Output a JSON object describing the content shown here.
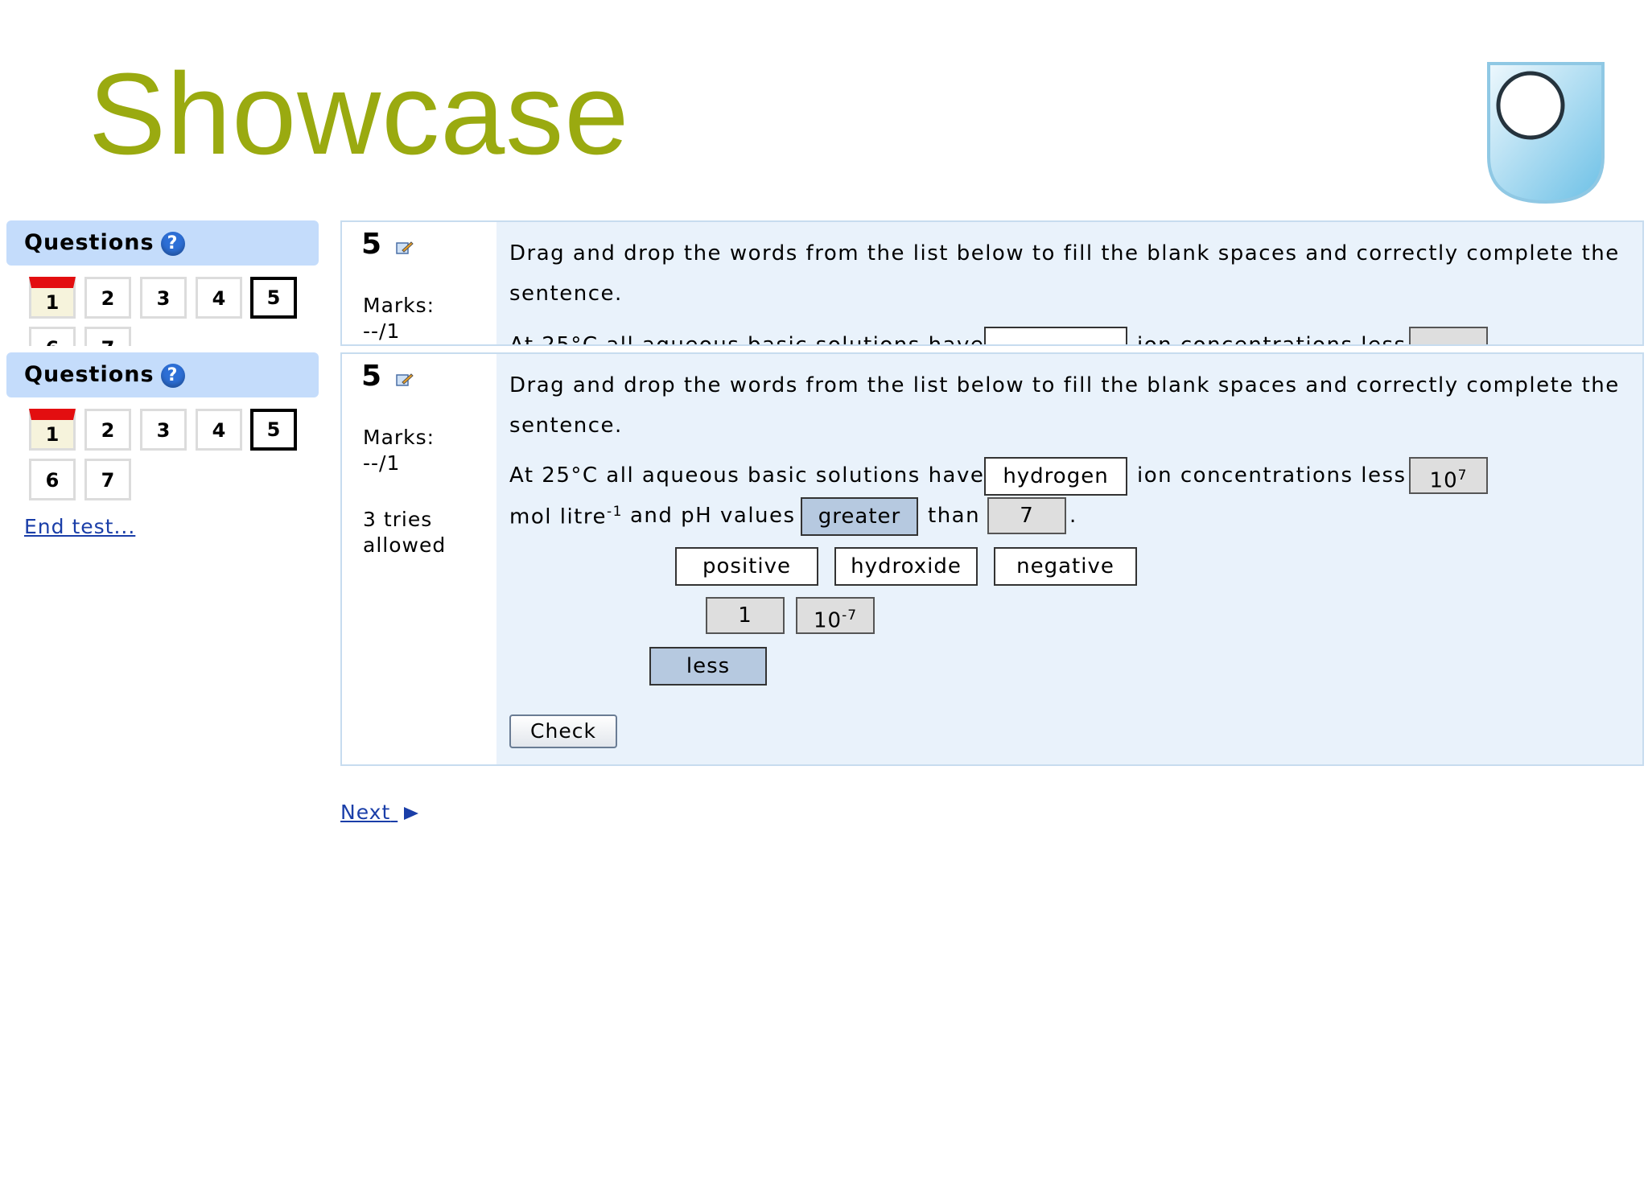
{
  "header": {
    "title": "Showcase"
  },
  "sidebar": {
    "heading": "Questions",
    "help_icon": "?",
    "question_numbers": [
      "1",
      "2",
      "3",
      "4",
      "5",
      "6",
      "7"
    ],
    "current": "5",
    "flagged": "1",
    "end_test": "End test..."
  },
  "question": {
    "number": "5",
    "marks_label": "Marks:",
    "marks_value": "--/1",
    "tries": "3 tries",
    "tries_suffix": "allowed",
    "instruction_line1": "Drag and drop the words from the list below to fill the blank spaces and correctly complete the",
    "instruction_line2": "sentence.",
    "sentence_part1": "At 25°C all aqueous basic solutions have",
    "sentence_part2": "ion concentrations less than",
    "sentence_part3": "mol litre",
    "sentence_part3_sup": "-1",
    "sentence_part4": "and pH values",
    "sentence_part5": "than",
    "sentence_end": ".",
    "filled": {
      "blank1": "hydrogen",
      "blank2_base": "10",
      "blank2_sup": "7",
      "blank3": "greater",
      "blank4": "7"
    },
    "word_options_row1": [
      "positive",
      "hydroxide",
      "negative"
    ],
    "word_options_row2_plain": "1",
    "word_options_row2_base": "10",
    "word_options_row2_sup": "-7",
    "word_options_row3": "less",
    "check_label": "Check"
  },
  "footer": {
    "next_label": "Next"
  },
  "colors": {
    "title": "#9aaa10",
    "panel": "#c4dcfb",
    "content_bg": "#e9f2fb",
    "link": "#1a3ea8",
    "flag": "#e30e10"
  }
}
